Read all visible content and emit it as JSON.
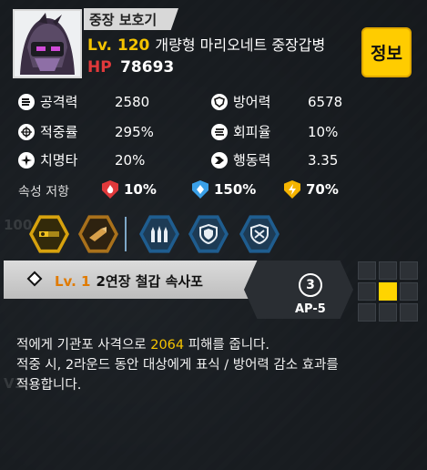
{
  "unit": {
    "name_tag": "중장 보호기",
    "level_text": "Lv. 120",
    "unit_name": "개량형 마리오네트 중장갑병",
    "hp_label": "HP",
    "hp_value": "78693",
    "info_button": "정보"
  },
  "stats": [
    {
      "icon": "attack-icon",
      "label": "공격력",
      "value": "2580"
    },
    {
      "icon": "defense-icon",
      "label": "방어력",
      "value": "6578"
    },
    {
      "icon": "accuracy-icon",
      "label": "적중률",
      "value": "295%"
    },
    {
      "icon": "evasion-icon",
      "label": "회피율",
      "value": "10%"
    },
    {
      "icon": "crit-icon",
      "label": "치명타",
      "value": "20%"
    },
    {
      "icon": "speed-icon",
      "label": "행동력",
      "value": "3.35"
    }
  ],
  "resistance": {
    "label": "속성 저항",
    "fire": {
      "value": "10%",
      "color": "#e0393b"
    },
    "ice": {
      "value": "150%",
      "color": "#3aa0e8"
    },
    "lightning": {
      "value": "70%",
      "color": "#f5b400"
    }
  },
  "skills_icons": [
    "machine-gun-skill-icon",
    "shell-skill-icon",
    "missile-barrage-icon",
    "shield-buff-icon",
    "shield-break-icon"
  ],
  "skill": {
    "level": "Lv. 1",
    "name": "2연장 철갑 속사포",
    "range": "3",
    "ap": "AP-5",
    "grid": [
      0,
      0,
      0,
      0,
      1,
      0,
      0,
      0,
      0
    ]
  },
  "description": {
    "line1_pre": "적에게 기관포 사격으로 ",
    "line1_num": "2064",
    "line1_post": " 피해를 줍니다.",
    "line2": "적중 시, 2라운드 동안 대상에게 표식 / 방어력 감소 효과를",
    "line3": "적용합니다."
  },
  "colors": {
    "accent": "#f5c400",
    "hp": "#e0393b",
    "info_bg": "#ffcc00"
  }
}
